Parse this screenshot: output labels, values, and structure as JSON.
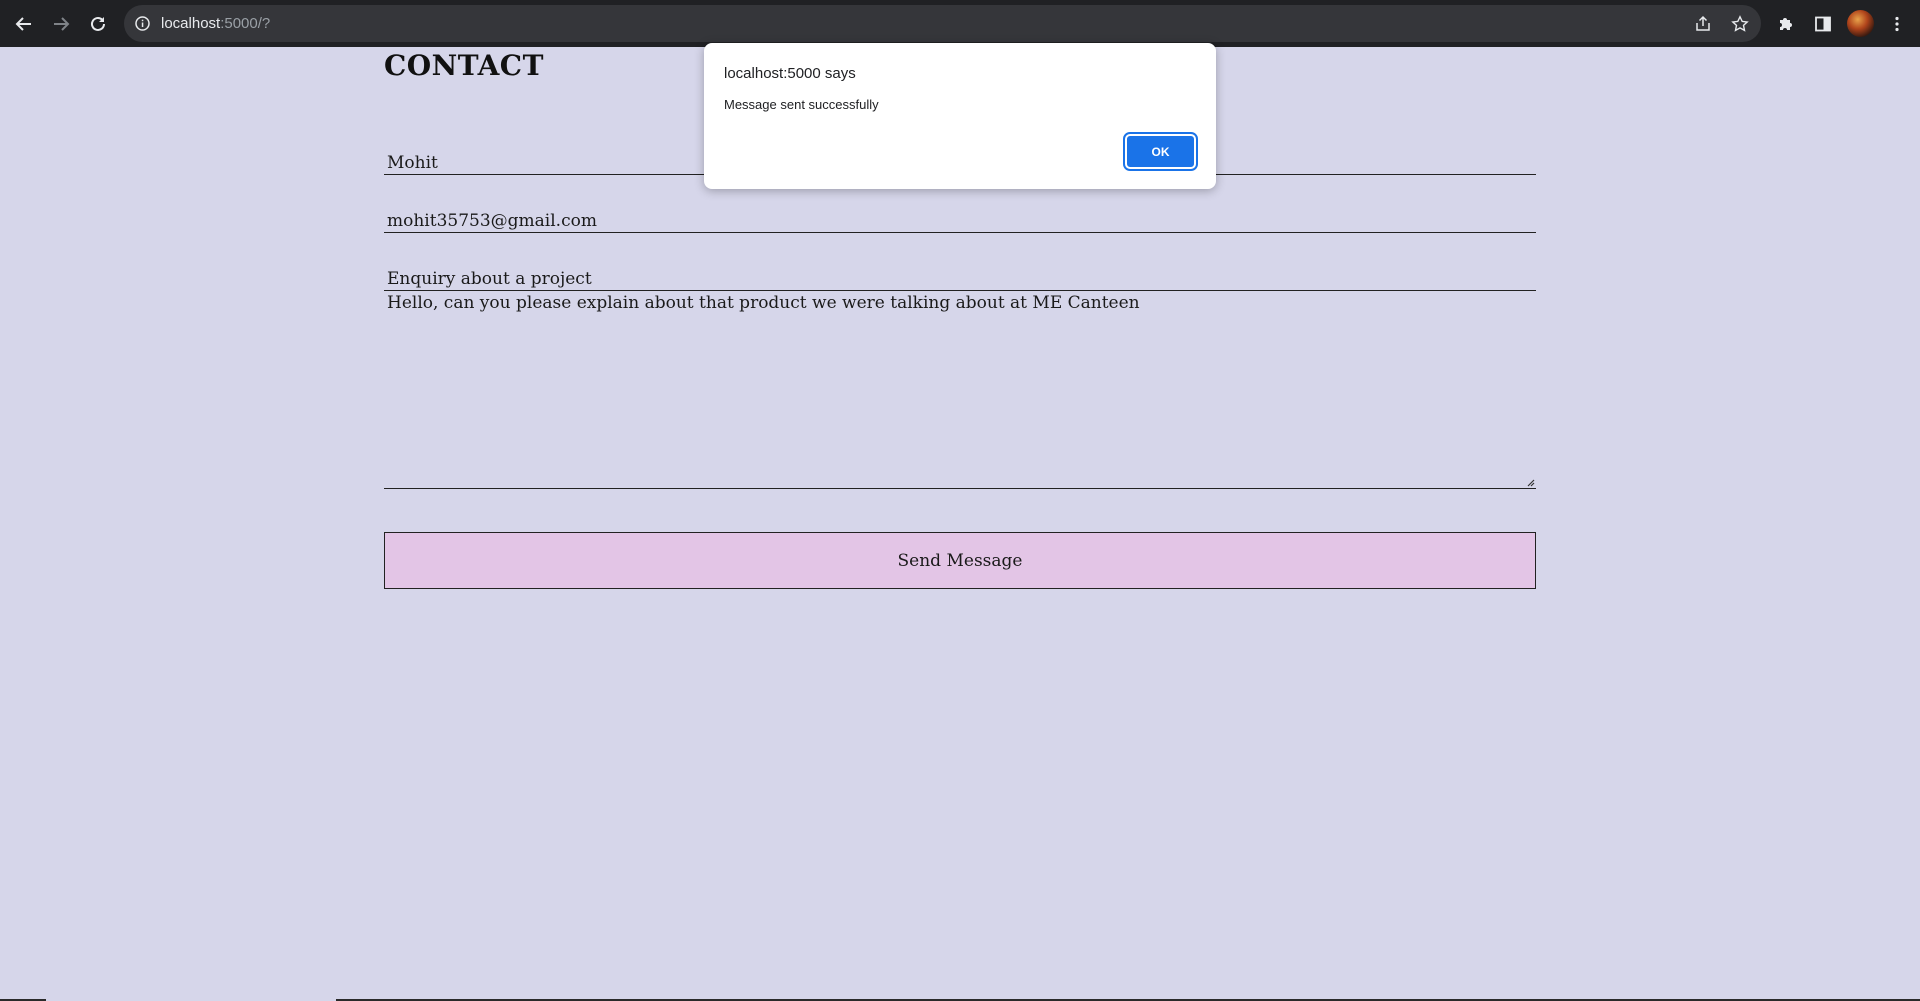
{
  "browser": {
    "url_host": "localhost",
    "url_rest": ":5000/?",
    "icons": {
      "back": "arrow-left-icon",
      "forward": "arrow-right-icon",
      "reload": "reload-icon",
      "info": "info-icon",
      "share": "share-icon",
      "bookmark": "star-icon",
      "extensions": "puzzle-icon",
      "side_panel": "side-panel-icon",
      "menu": "kebab-menu-icon"
    }
  },
  "page": {
    "title": "CONTACT",
    "fields": {
      "name": "Mohit",
      "email": "mohit35753@gmail.com",
      "subject": "Enquiry about a project",
      "message": "Hello, can you please explain about that product we were talking about at ME Canteen"
    },
    "send_label": "Send Message",
    "colors": {
      "background": "#d6d6ea",
      "button": "#e3c5e6"
    }
  },
  "dialog": {
    "title": "localhost:5000 says",
    "message": "Message sent successfully",
    "ok_label": "OK",
    "ok_color": "#1a73e8"
  }
}
